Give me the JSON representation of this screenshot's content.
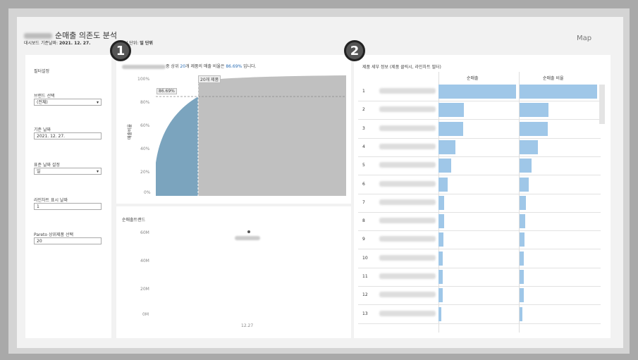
{
  "header": {
    "title": "순매출 의존도 분석",
    "subtitle_prefix": "대시보드 기준날짜: ",
    "subtitle_date": "2021. 12. 27.",
    "subtitle_mid": "표시 단위: ",
    "subtitle_unit": "일 단위",
    "map_link": "Map"
  },
  "badges": [
    "1",
    "2"
  ],
  "filters": {
    "heading": "필터설정",
    "brand_label": "브랜드 선택",
    "brand_value": "(전체)",
    "date_label": "기준 날짜",
    "date_value": "2021. 12. 27.",
    "unit_label": "표준 날짜 설정",
    "unit_value": "일",
    "line_label": "라인차트 표시 날짜",
    "line_value": "1",
    "pareto_label": "Pareto 상위제품 선택",
    "pareto_value": "20"
  },
  "pareto": {
    "caption_mid": "중 상위 ",
    "caption_count": "20",
    "caption_mid2": "개 제품의 매출 비율은 ",
    "caption_pct": "86.69%",
    "caption_end": " 입니다.",
    "ylabel": "매출비율",
    "yticks": [
      "100%",
      "80%",
      "60%",
      "40%",
      "20%",
      "0%"
    ],
    "ref_label": "20개 제품",
    "ref_pct": "86.69%"
  },
  "trend": {
    "title": "순매출트랜드",
    "yticks": [
      "60M",
      "40M",
      "20M",
      "0M"
    ],
    "xtick": "12.27"
  },
  "table": {
    "title": "제품 세부 정보 (제품 클릭시, 라인차트 필터)",
    "col1": "순매출",
    "col2": "순매출 비율",
    "rows": [
      {
        "n": "1",
        "a": 1.0,
        "b": 1.0
      },
      {
        "n": "2",
        "a": 0.33,
        "b": 0.37
      },
      {
        "n": "3",
        "a": 0.32,
        "b": 0.36
      },
      {
        "n": "4",
        "a": 0.22,
        "b": 0.24
      },
      {
        "n": "5",
        "a": 0.16,
        "b": 0.15
      },
      {
        "n": "6",
        "a": 0.12,
        "b": 0.12
      },
      {
        "n": "7",
        "a": 0.07,
        "b": 0.08
      },
      {
        "n": "8",
        "a": 0.07,
        "b": 0.07
      },
      {
        "n": "9",
        "a": 0.06,
        "b": 0.06
      },
      {
        "n": "10",
        "a": 0.05,
        "b": 0.05
      },
      {
        "n": "11",
        "a": 0.05,
        "b": 0.05
      },
      {
        "n": "12",
        "a": 0.05,
        "b": 0.05
      },
      {
        "n": "13",
        "a": 0.04,
        "b": 0.04
      }
    ]
  }
}
